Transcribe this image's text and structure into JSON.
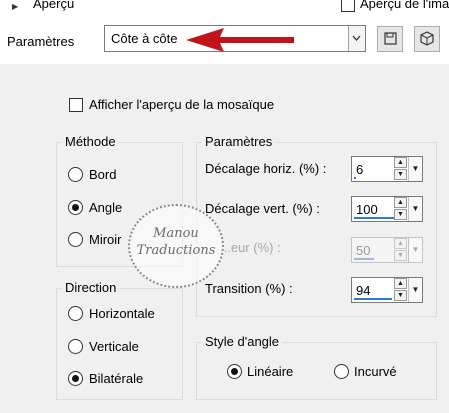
{
  "top": {
    "preview_label": "Aperçu",
    "image_preview_label": "Aperçu de l'ima",
    "params_label": "Paramètres",
    "preset_value": "Côte à côte",
    "arrow_color": "#c0141a"
  },
  "mosaic_preview_label": "Afficher l'aperçu de la mosaïque",
  "method": {
    "title": "Méthode",
    "options": [
      "Bord",
      "Angle",
      "Miroir"
    ],
    "selected": "Angle"
  },
  "direction": {
    "title": "Direction",
    "options": [
      "Horizontale",
      "Verticale",
      "Bilatérale"
    ],
    "selected": "Bilatérale"
  },
  "params": {
    "title": "Paramètres",
    "horiz_label": "Décalage horiz. (%) :",
    "horiz_value": "6",
    "horiz_fill": 0.06,
    "vert_label": "Décalage vert. (%) :",
    "vert_value": "100",
    "vert_fill": 1.0,
    "angle_label": "...eur (%) :",
    "angle_value": "50",
    "angle_fill": 0.5,
    "transition_label": "Transition (%) :",
    "transition_value": "94",
    "transition_fill": 0.94
  },
  "corner_style": {
    "title": "Style d'angle",
    "options": [
      "Linéaire",
      "Incurvé"
    ],
    "selected": "Linéaire"
  },
  "watermark": {
    "line1": "Manou",
    "line2": "Traductions"
  }
}
